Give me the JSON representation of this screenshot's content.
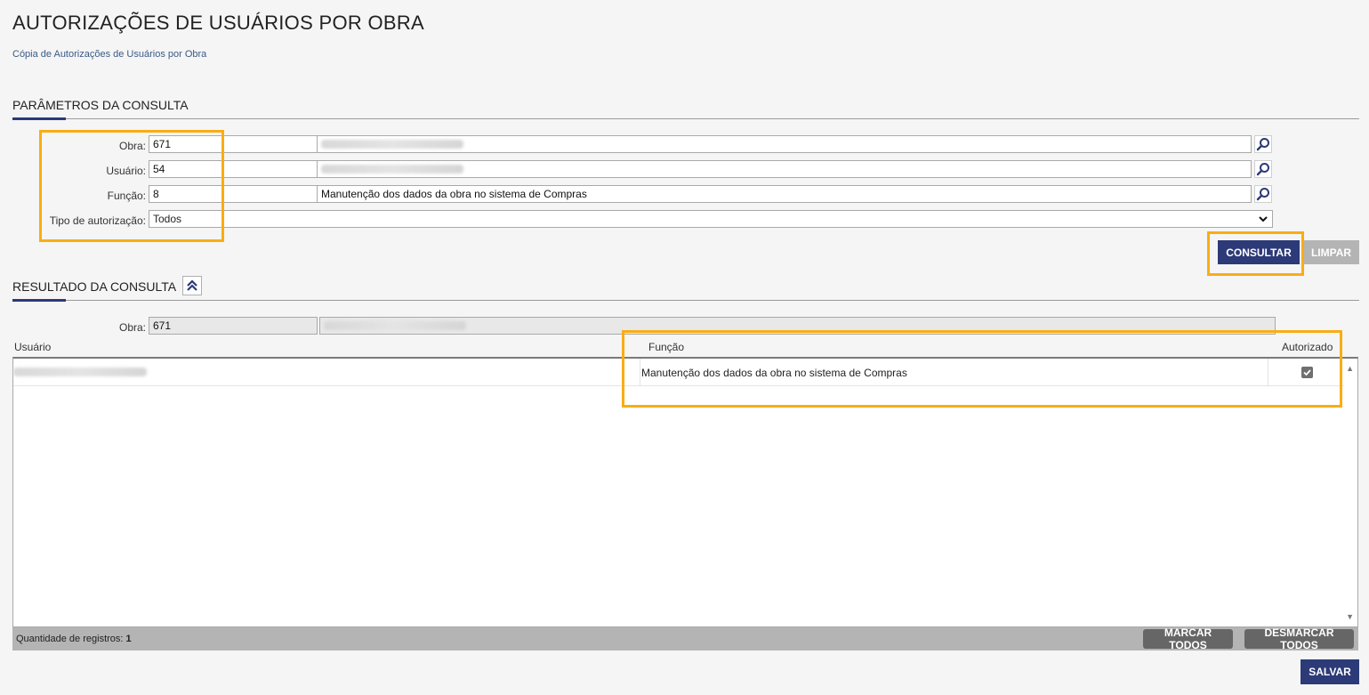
{
  "page": {
    "title": "AUTORIZAÇÕES DE USUÁRIOS POR OBRA",
    "link": "Cópia de Autorizações de Usuários por Obra"
  },
  "params": {
    "header": "PARÂMETROS DA CONSULTA",
    "obra": {
      "label": "Obra:",
      "code": "671"
    },
    "usuario": {
      "label": "Usuário:",
      "code": "54"
    },
    "funcao": {
      "label": "Função:",
      "code": "8",
      "description": "Manutenção dos dados da obra no sistema de Compras"
    },
    "tipo": {
      "label": "Tipo de autorização:",
      "selected": "Todos"
    },
    "consultar_label": "CONSULTAR",
    "limpar_label": "LIMPAR"
  },
  "results": {
    "header": "RESULTADO DA CONSULTA",
    "obra": {
      "label": "Obra:",
      "code": "671"
    },
    "columns": {
      "usuario": "Usuário",
      "funcao": "Função",
      "autorizado": "Autorizado"
    },
    "rows": [
      {
        "funcao": "Manutenção dos dados da obra no sistema de Compras",
        "autorizado": true
      }
    ],
    "count_label": "Quantidade de registros:",
    "count_value": "1",
    "marcar_todos_label": "MARCAR TODOS",
    "desmarcar_todos_label": "DESMARCAR TODOS",
    "salvar_label": "SALVAR"
  },
  "colors": {
    "primary": "#2c3a78",
    "highlight": "#f9ad14",
    "gray_button": "#b4b4b4"
  },
  "icons": {
    "lookup": "search-icon",
    "collapse": "double-chevron-up-icon",
    "select": "chevron-down-icon",
    "checkbox": "checkmark-icon"
  }
}
